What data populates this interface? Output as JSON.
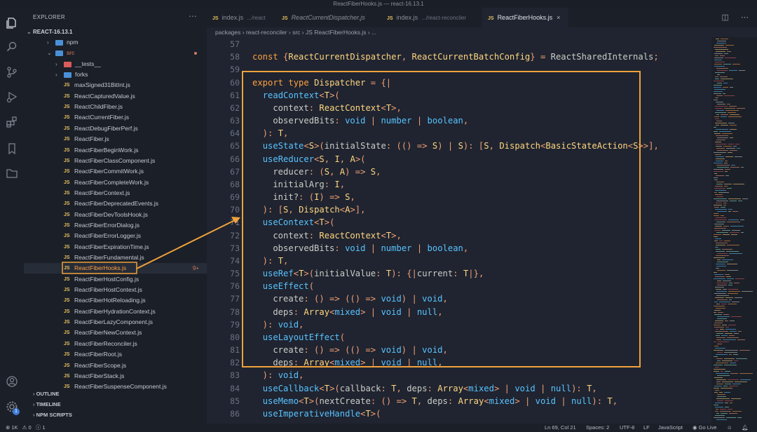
{
  "window": {
    "title": "ReactFiberHooks.js — react-16.13.1"
  },
  "sidebar": {
    "title": "EXPLORER",
    "more_icon": "ellipsis-icon",
    "root": "REACT-16.13.1",
    "items": [
      {
        "type": "folder",
        "label": "npm",
        "indent": 1,
        "chevron": "›",
        "folder_color": "#4a90d9"
      },
      {
        "type": "folder",
        "label": "src",
        "indent": 1,
        "chevron": "⌄",
        "folder_color": "#4a90d9",
        "label_color": "#e07b5a",
        "modified": true
      },
      {
        "type": "folder",
        "label": "__tests__",
        "indent": 2,
        "chevron": "›",
        "folder_color": "#d95b5b"
      },
      {
        "type": "folder",
        "label": "forks",
        "indent": 2,
        "chevron": "›",
        "folder_color": "#4a90d9"
      },
      {
        "type": "file",
        "label": "maxSigned31BitInt.js"
      },
      {
        "type": "file",
        "label": "ReactCapturedValue.js"
      },
      {
        "type": "file",
        "label": "ReactChildFiber.js"
      },
      {
        "type": "file",
        "label": "ReactCurrentFiber.js"
      },
      {
        "type": "file",
        "label": "ReactDebugFiberPerf.js"
      },
      {
        "type": "file",
        "label": "ReactFiber.js"
      },
      {
        "type": "file",
        "label": "ReactFiberBeginWork.js"
      },
      {
        "type": "file",
        "label": "ReactFiberClassComponent.js"
      },
      {
        "type": "file",
        "label": "ReactFiberCommitWork.js"
      },
      {
        "type": "file",
        "label": "ReactFiberCompleteWork.js"
      },
      {
        "type": "file",
        "label": "ReactFiberContext.js"
      },
      {
        "type": "file",
        "label": "ReactFiberDeprecatedEvents.js"
      },
      {
        "type": "file",
        "label": "ReactFiberDevToolsHook.js"
      },
      {
        "type": "file",
        "label": "ReactFiberErrorDialog.js"
      },
      {
        "type": "file",
        "label": "ReactFiberErrorLogger.js"
      },
      {
        "type": "file",
        "label": "ReactFiberExpirationTime.js"
      },
      {
        "type": "file",
        "label": "ReactFiberFundamental.js"
      },
      {
        "type": "file",
        "label": "ReactFiberHooks.js",
        "selected": true,
        "badge": "9+"
      },
      {
        "type": "file",
        "label": "ReactFiberHostConfig.js"
      },
      {
        "type": "file",
        "label": "ReactFiberHostContext.js"
      },
      {
        "type": "file",
        "label": "ReactFiberHotReloading.js"
      },
      {
        "type": "file",
        "label": "ReactFiberHydrationContext.js"
      },
      {
        "type": "file",
        "label": "ReactFiberLazyComponent.js"
      },
      {
        "type": "file",
        "label": "ReactFiberNewContext.js"
      },
      {
        "type": "file",
        "label": "ReactFiberReconciler.js"
      },
      {
        "type": "file",
        "label": "ReactFiberRoot.js"
      },
      {
        "type": "file",
        "label": "ReactFiberScope.js"
      },
      {
        "type": "file",
        "label": "ReactFiberStack.js"
      },
      {
        "type": "file",
        "label": "ReactFiberSuspenseComponent.js"
      }
    ],
    "sections": [
      "OUTLINE",
      "TIMELINE",
      "NPM SCRIPTS"
    ]
  },
  "activity_bar": [
    "files-icon",
    "search-icon",
    "source-control-icon",
    "run-debug-icon",
    "extensions-icon",
    "bookmark-icon",
    "folder-icon",
    "account-icon",
    "settings-gear-icon"
  ],
  "activity_badge": "1",
  "tabs": [
    {
      "badge": "JS",
      "label": "index.js",
      "path": ".../react",
      "italic": false
    },
    {
      "badge": "JS",
      "label": "ReactCurrentDispatcher.js",
      "path": "",
      "italic": true
    },
    {
      "badge": "JS",
      "label": "index.js",
      "path": ".../react-reconciler",
      "italic": false
    },
    {
      "badge": "JS",
      "label": "ReactFiberHooks.js",
      "path": "",
      "italic": false,
      "active": true,
      "close": "×"
    }
  ],
  "tab_actions": {
    "split": "split-editor-icon",
    "more": "ellipsis-icon"
  },
  "breadcrumb": [
    "packages",
    "react-reconciler",
    "src",
    "JS ReactFiberHooks.js",
    "..."
  ],
  "editor": {
    "lines": [
      {
        "n": "57",
        "tokens": []
      },
      {
        "n": "58",
        "tokens": [
          [
            "k",
            "const "
          ],
          [
            "p",
            "{"
          ],
          [
            "ty",
            "ReactCurrentDispatcher"
          ],
          [
            "p",
            ", "
          ],
          [
            "ty",
            "ReactCurrentBatchConfig"
          ],
          [
            "p",
            "} = "
          ],
          [
            "t",
            "ReactSharedInternals"
          ],
          [
            "p",
            ";"
          ]
        ]
      },
      {
        "n": "59",
        "tokens": []
      },
      {
        "n": "60",
        "tokens": [
          [
            "k",
            "export type "
          ],
          [
            "ty",
            "Dispatcher"
          ],
          [
            "p",
            " = {|"
          ]
        ]
      },
      {
        "n": "61",
        "tokens": [
          [
            "t",
            "  "
          ],
          [
            "f",
            "readContext"
          ],
          [
            "p",
            "<"
          ],
          [
            "ty",
            "T"
          ],
          [
            "p",
            ">("
          ]
        ]
      },
      {
        "n": "62",
        "tokens": [
          [
            "t",
            "    context"
          ],
          [
            "p",
            ": "
          ],
          [
            "ty",
            "ReactContext"
          ],
          [
            "p",
            "<"
          ],
          [
            "ty",
            "T"
          ],
          [
            "p",
            ">,"
          ]
        ]
      },
      {
        "n": "63",
        "tokens": [
          [
            "t",
            "    observedBits"
          ],
          [
            "p",
            ": "
          ],
          [
            "b",
            "void"
          ],
          [
            "p",
            " | "
          ],
          [
            "b",
            "number"
          ],
          [
            "p",
            " | "
          ],
          [
            "b",
            "boolean"
          ],
          [
            "p",
            ","
          ]
        ]
      },
      {
        "n": "64",
        "tokens": [
          [
            "p",
            "  ): "
          ],
          [
            "ty",
            "T"
          ],
          [
            "p",
            ","
          ]
        ]
      },
      {
        "n": "65",
        "tokens": [
          [
            "t",
            "  "
          ],
          [
            "f",
            "useState"
          ],
          [
            "p",
            "<"
          ],
          [
            "ty",
            "S"
          ],
          [
            "p",
            ">("
          ],
          [
            "t",
            "initialState"
          ],
          [
            "p",
            ": (() => "
          ],
          [
            "ty",
            "S"
          ],
          [
            "p",
            ") | "
          ],
          [
            "ty",
            "S"
          ],
          [
            "p",
            "): ["
          ],
          [
            "ty",
            "S"
          ],
          [
            "p",
            ", "
          ],
          [
            "ty",
            "Dispatch"
          ],
          [
            "p",
            "<"
          ],
          [
            "ty",
            "BasicStateAction"
          ],
          [
            "p",
            "<"
          ],
          [
            "ty",
            "S"
          ],
          [
            "p",
            ">>],"
          ]
        ]
      },
      {
        "n": "66",
        "tokens": [
          [
            "t",
            "  "
          ],
          [
            "f",
            "useReducer"
          ],
          [
            "p",
            "<"
          ],
          [
            "ty",
            "S"
          ],
          [
            "p",
            ", "
          ],
          [
            "ty",
            "I"
          ],
          [
            "p",
            ", "
          ],
          [
            "ty",
            "A"
          ],
          [
            "p",
            ">("
          ]
        ]
      },
      {
        "n": "67",
        "tokens": [
          [
            "t",
            "    reducer"
          ],
          [
            "p",
            ": ("
          ],
          [
            "ty",
            "S"
          ],
          [
            "p",
            ", "
          ],
          [
            "ty",
            "A"
          ],
          [
            "p",
            ") => "
          ],
          [
            "ty",
            "S"
          ],
          [
            "p",
            ","
          ]
        ]
      },
      {
        "n": "68",
        "tokens": [
          [
            "t",
            "    initialArg"
          ],
          [
            "p",
            ": "
          ],
          [
            "ty",
            "I"
          ],
          [
            "p",
            ","
          ]
        ]
      },
      {
        "n": "69",
        "tokens": [
          [
            "t",
            "    init?"
          ],
          [
            "p",
            ": ("
          ],
          [
            "ty",
            "I"
          ],
          [
            "p",
            ") => "
          ],
          [
            "ty",
            "S"
          ],
          [
            "p",
            ","
          ]
        ]
      },
      {
        "n": "70",
        "tokens": [
          [
            "p",
            "  ): ["
          ],
          [
            "ty",
            "S"
          ],
          [
            "p",
            ", "
          ],
          [
            "ty",
            "Dispatch"
          ],
          [
            "p",
            "<"
          ],
          [
            "ty",
            "A"
          ],
          [
            "p",
            ">],"
          ]
        ]
      },
      {
        "n": "71",
        "tokens": [
          [
            "t",
            "  "
          ],
          [
            "f",
            "useContext"
          ],
          [
            "p",
            "<"
          ],
          [
            "ty",
            "T"
          ],
          [
            "p",
            ">("
          ]
        ]
      },
      {
        "n": "72",
        "tokens": [
          [
            "t",
            "    context"
          ],
          [
            "p",
            ": "
          ],
          [
            "ty",
            "ReactContext"
          ],
          [
            "p",
            "<"
          ],
          [
            "ty",
            "T"
          ],
          [
            "p",
            ">,"
          ]
        ]
      },
      {
        "n": "73",
        "tokens": [
          [
            "t",
            "    observedBits"
          ],
          [
            "p",
            ": "
          ],
          [
            "b",
            "void"
          ],
          [
            "p",
            " | "
          ],
          [
            "b",
            "number"
          ],
          [
            "p",
            " | "
          ],
          [
            "b",
            "boolean"
          ],
          [
            "p",
            ","
          ]
        ]
      },
      {
        "n": "74",
        "tokens": [
          [
            "p",
            "  ): "
          ],
          [
            "ty",
            "T"
          ],
          [
            "p",
            ","
          ]
        ]
      },
      {
        "n": "75",
        "tokens": [
          [
            "t",
            "  "
          ],
          [
            "f",
            "useRef"
          ],
          [
            "p",
            "<"
          ],
          [
            "ty",
            "T"
          ],
          [
            "p",
            ">("
          ],
          [
            "t",
            "initialValue"
          ],
          [
            "p",
            ": "
          ],
          [
            "ty",
            "T"
          ],
          [
            "p",
            "): {|"
          ],
          [
            "t",
            "current"
          ],
          [
            "p",
            ": "
          ],
          [
            "ty",
            "T"
          ],
          [
            "p",
            "|},"
          ]
        ]
      },
      {
        "n": "76",
        "tokens": [
          [
            "t",
            "  "
          ],
          [
            "f",
            "useEffect"
          ],
          [
            "p",
            "("
          ]
        ]
      },
      {
        "n": "77",
        "tokens": [
          [
            "t",
            "    create"
          ],
          [
            "p",
            ": () => (() => "
          ],
          [
            "b",
            "void"
          ],
          [
            "p",
            ") | "
          ],
          [
            "b",
            "void"
          ],
          [
            "p",
            ","
          ]
        ]
      },
      {
        "n": "78",
        "tokens": [
          [
            "t",
            "    deps"
          ],
          [
            "p",
            ": "
          ],
          [
            "ty",
            "Array"
          ],
          [
            "p",
            "<"
          ],
          [
            "b",
            "mixed"
          ],
          [
            "p",
            "> | "
          ],
          [
            "b",
            "void"
          ],
          [
            "p",
            " | "
          ],
          [
            "b",
            "null"
          ],
          [
            "p",
            ","
          ]
        ]
      },
      {
        "n": "79",
        "tokens": [
          [
            "p",
            "  ): "
          ],
          [
            "b",
            "void"
          ],
          [
            "p",
            ","
          ]
        ]
      },
      {
        "n": "80",
        "tokens": [
          [
            "t",
            "  "
          ],
          [
            "f",
            "useLayoutEffect"
          ],
          [
            "p",
            "("
          ]
        ]
      },
      {
        "n": "81",
        "tokens": [
          [
            "t",
            "    create"
          ],
          [
            "p",
            ": () => (() => "
          ],
          [
            "b",
            "void"
          ],
          [
            "p",
            ") | "
          ],
          [
            "b",
            "void"
          ],
          [
            "p",
            ","
          ]
        ]
      },
      {
        "n": "82",
        "tokens": [
          [
            "t",
            "    deps"
          ],
          [
            "p",
            ": "
          ],
          [
            "ty",
            "Array"
          ],
          [
            "p",
            "<"
          ],
          [
            "b",
            "mixed"
          ],
          [
            "p",
            "> | "
          ],
          [
            "b",
            "void"
          ],
          [
            "p",
            " | "
          ],
          [
            "b",
            "null"
          ],
          [
            "p",
            ","
          ]
        ]
      },
      {
        "n": "83",
        "tokens": [
          [
            "p",
            "  ): "
          ],
          [
            "b",
            "void"
          ],
          [
            "p",
            ","
          ]
        ]
      },
      {
        "n": "84",
        "tokens": [
          [
            "t",
            "  "
          ],
          [
            "f",
            "useCallback"
          ],
          [
            "p",
            "<"
          ],
          [
            "ty",
            "T"
          ],
          [
            "p",
            ">("
          ],
          [
            "t",
            "callback"
          ],
          [
            "p",
            ": "
          ],
          [
            "ty",
            "T"
          ],
          [
            "p",
            ", "
          ],
          [
            "t",
            "deps"
          ],
          [
            "p",
            ": "
          ],
          [
            "ty",
            "Array"
          ],
          [
            "p",
            "<"
          ],
          [
            "b",
            "mixed"
          ],
          [
            "p",
            "> | "
          ],
          [
            "b",
            "void"
          ],
          [
            "p",
            " | "
          ],
          [
            "b",
            "null"
          ],
          [
            "p",
            "): "
          ],
          [
            "ty",
            "T"
          ],
          [
            "p",
            ","
          ]
        ]
      },
      {
        "n": "85",
        "tokens": [
          [
            "t",
            "  "
          ],
          [
            "f",
            "useMemo"
          ],
          [
            "p",
            "<"
          ],
          [
            "ty",
            "T"
          ],
          [
            "p",
            ">("
          ],
          [
            "t",
            "nextCreate"
          ],
          [
            "p",
            ": () => "
          ],
          [
            "ty",
            "T"
          ],
          [
            "p",
            ", "
          ],
          [
            "t",
            "deps"
          ],
          [
            "p",
            ": "
          ],
          [
            "ty",
            "Array"
          ],
          [
            "p",
            "<"
          ],
          [
            "b",
            "mixed"
          ],
          [
            "p",
            "> | "
          ],
          [
            "b",
            "void"
          ],
          [
            "p",
            " | "
          ],
          [
            "b",
            "null"
          ],
          [
            "p",
            "): "
          ],
          [
            "ty",
            "T"
          ],
          [
            "p",
            ","
          ]
        ]
      },
      {
        "n": "86",
        "tokens": [
          [
            "t",
            "  "
          ],
          [
            "f",
            "useImperativeHandle"
          ],
          [
            "p",
            "<"
          ],
          [
            "ty",
            "T"
          ],
          [
            "p",
            ">("
          ]
        ]
      }
    ]
  },
  "syntax_colors": {
    "k": "#ff9f40",
    "ty": "#ffd580",
    "f": "#59c2ff",
    "b": "#59c2ff",
    "p": "#f29e74",
    "t": "#cbccc6"
  },
  "annotation": {
    "color": "#f0a23b"
  },
  "status": {
    "errors": "1K",
    "warnings": "0",
    "info": "1",
    "position": "Ln 69, Col 21",
    "spaces": "Spaces: 2",
    "encoding": "UTF-8",
    "eol": "LF",
    "language": "JavaScript",
    "golive": "Go Live"
  }
}
